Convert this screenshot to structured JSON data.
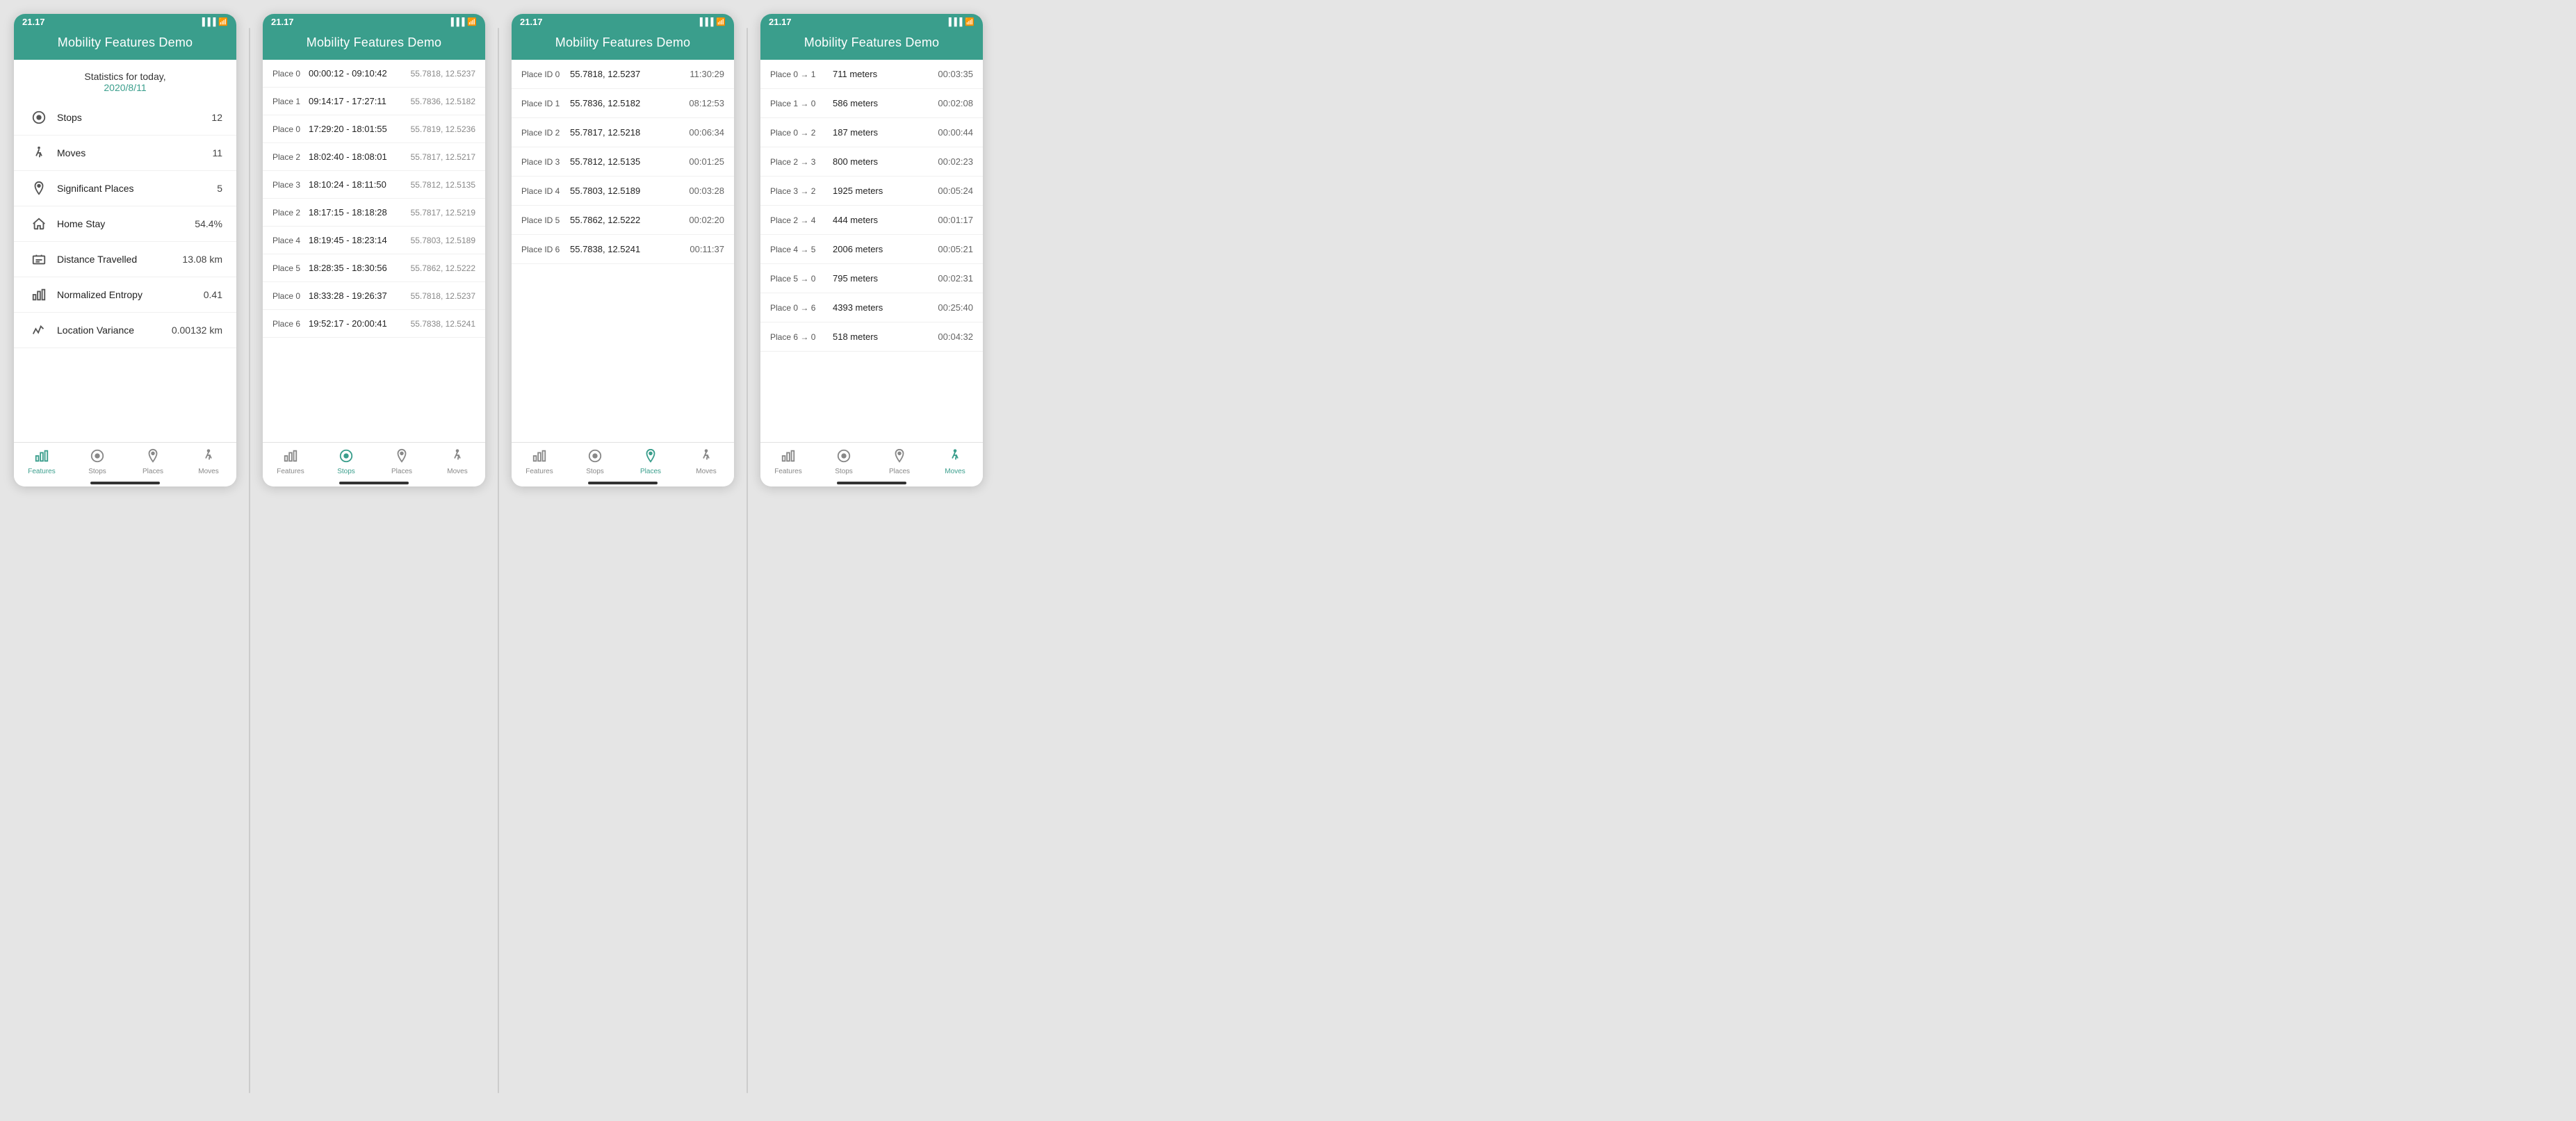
{
  "screens": [
    {
      "id": "features",
      "status_time": "21.17",
      "header_title": "Mobility Features Demo",
      "stats_label": "Statistics for today,",
      "date": "2020/8/11",
      "stats": [
        {
          "icon": "location-circle",
          "label": "Stops",
          "value": "12"
        },
        {
          "icon": "walk",
          "label": "Moves",
          "value": "11"
        },
        {
          "icon": "pin",
          "label": "Significant Places",
          "value": "5"
        },
        {
          "icon": "home",
          "label": "Home Stay",
          "value": "54.4%"
        },
        {
          "icon": "briefcase",
          "label": "Distance Travelled",
          "value": "13.08 km"
        },
        {
          "icon": "bar-chart",
          "label": "Normalized Entropy",
          "value": "0.41"
        },
        {
          "icon": "variance",
          "label": "Location Variance",
          "value": "0.00132 km"
        }
      ],
      "tabs": [
        {
          "label": "Features",
          "icon": "bar",
          "active": true
        },
        {
          "label": "Stops",
          "icon": "circle",
          "active": false
        },
        {
          "label": "Places",
          "icon": "pin",
          "active": false
        },
        {
          "label": "Moves",
          "icon": "walk",
          "active": false
        }
      ]
    },
    {
      "id": "stops",
      "status_time": "21.17",
      "header_title": "Mobility Features Demo",
      "stops": [
        {
          "place": "Place 0",
          "time": "00:00:12 - 09:10:42",
          "coords": "55.7818, 12.5237"
        },
        {
          "place": "Place 1",
          "time": "09:14:17 - 17:27:11",
          "coords": "55.7836, 12.5182"
        },
        {
          "place": "Place 0",
          "time": "17:29:20 - 18:01:55",
          "coords": "55.7819, 12.5236"
        },
        {
          "place": "Place 2",
          "time": "18:02:40 - 18:08:01",
          "coords": "55.7817, 12.5217"
        },
        {
          "place": "Place 3",
          "time": "18:10:24 - 18:11:50",
          "coords": "55.7812, 12.5135"
        },
        {
          "place": "Place 2",
          "time": "18:17:15 - 18:18:28",
          "coords": "55.7817, 12.5219"
        },
        {
          "place": "Place 4",
          "time": "18:19:45 - 18:23:14",
          "coords": "55.7803, 12.5189"
        },
        {
          "place": "Place 5",
          "time": "18:28:35 - 18:30:56",
          "coords": "55.7862, 12.5222"
        },
        {
          "place": "Place 0",
          "time": "18:33:28 - 19:26:37",
          "coords": "55.7818, 12.5237"
        },
        {
          "place": "Place 6",
          "time": "19:52:17 - 20:00:41",
          "coords": "55.7838, 12.5241"
        }
      ],
      "tabs": [
        {
          "label": "Features",
          "icon": "bar",
          "active": false
        },
        {
          "label": "Stops",
          "icon": "circle",
          "active": true
        },
        {
          "label": "Places",
          "icon": "pin",
          "active": false
        },
        {
          "label": "Moves",
          "icon": "walk",
          "active": false
        }
      ]
    },
    {
      "id": "places",
      "status_time": "21.17",
      "header_title": "Mobility Features Demo",
      "places": [
        {
          "id": "Place ID 0",
          "coords": "55.7818, 12.5237",
          "duration": "11:30:29"
        },
        {
          "id": "Place ID 1",
          "coords": "55.7836, 12.5182",
          "duration": "08:12:53"
        },
        {
          "id": "Place ID 2",
          "coords": "55.7817, 12.5218",
          "duration": "00:06:34"
        },
        {
          "id": "Place ID 3",
          "coords": "55.7812, 12.5135",
          "duration": "00:01:25"
        },
        {
          "id": "Place ID 4",
          "coords": "55.7803, 12.5189",
          "duration": "00:03:28"
        },
        {
          "id": "Place ID 5",
          "coords": "55.7862, 12.5222",
          "duration": "00:02:20"
        },
        {
          "id": "Place ID 6",
          "coords": "55.7838, 12.5241",
          "duration": "00:11:37"
        }
      ],
      "tabs": [
        {
          "label": "Features",
          "icon": "bar",
          "active": false
        },
        {
          "label": "Stops",
          "icon": "circle",
          "active": false
        },
        {
          "label": "Places",
          "icon": "pin",
          "active": true
        },
        {
          "label": "Moves",
          "icon": "walk",
          "active": false
        }
      ]
    },
    {
      "id": "moves",
      "status_time": "21.17",
      "header_title": "Mobility Features Demo",
      "moves": [
        {
          "route": "Place 0 → 1",
          "distance": "711 meters",
          "duration": "00:03:35"
        },
        {
          "route": "Place 1 → 0",
          "distance": "586 meters",
          "duration": "00:02:08"
        },
        {
          "route": "Place 0 → 2",
          "distance": "187 meters",
          "duration": "00:00:44"
        },
        {
          "route": "Place 2 → 3",
          "distance": "800 meters",
          "duration": "00:02:23"
        },
        {
          "route": "Place 3 → 2",
          "distance": "1925 meters",
          "duration": "00:05:24"
        },
        {
          "route": "Place 2 → 4",
          "distance": "444 meters",
          "duration": "00:01:17"
        },
        {
          "route": "Place 4 → 5",
          "distance": "2006 meters",
          "duration": "00:05:21"
        },
        {
          "route": "Place 5 → 0",
          "distance": "795 meters",
          "duration": "00:02:31"
        },
        {
          "route": "Place 0 → 6",
          "distance": "4393 meters",
          "duration": "00:25:40"
        },
        {
          "route": "Place 6 → 0",
          "distance": "518 meters",
          "duration": "00:04:32"
        }
      ],
      "tabs": [
        {
          "label": "Features",
          "icon": "bar",
          "active": false
        },
        {
          "label": "Stops",
          "icon": "circle",
          "active": false
        },
        {
          "label": "Places",
          "icon": "pin",
          "active": false
        },
        {
          "label": "Moves",
          "icon": "walk",
          "active": true
        }
      ]
    }
  ]
}
